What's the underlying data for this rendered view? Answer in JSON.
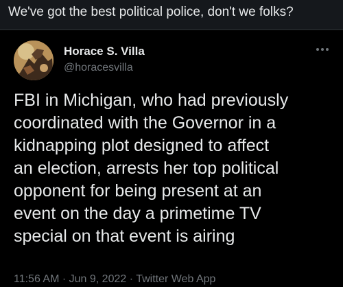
{
  "quote": {
    "text": "We've got the best political police, don't we folks?"
  },
  "tweet": {
    "author_name": "Horace S. Villa",
    "author_handle": "@horacesvilla",
    "more_icon": "more-horizontal-icon",
    "body": "FBI in Michigan, who had previously\ncoordinated with the Governor in a\nkidnapping plot designed to affect\nan election, arrests her top political\nopponent for being present at an\nevent on the day a primetime TV\nspecial on that event is airing",
    "time": "11:56 AM",
    "separator": " · ",
    "date": "Jun 9, 2022",
    "source": "Twitter Web App"
  },
  "colors": {
    "background": "#000000",
    "quote_bar": "#15181c",
    "text_primary": "#e7e9ea",
    "text_secondary": "#71767b"
  }
}
